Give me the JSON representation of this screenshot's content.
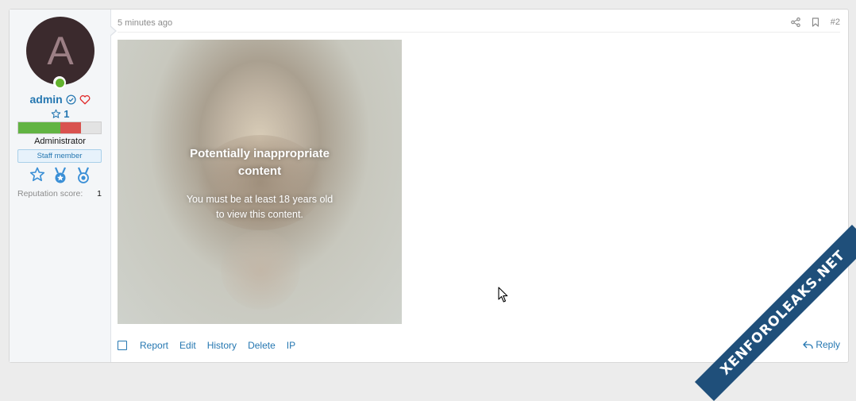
{
  "post": {
    "time": "5 minutes ago",
    "number": "#2"
  },
  "user": {
    "avatar_letter": "A",
    "name": "admin",
    "rank_count": "1",
    "title": "Administrator",
    "badge": "Staff member",
    "reputation_label": "Reputation score:",
    "reputation_value": "1",
    "reputation_bar": {
      "positive_fraction": 0.51,
      "negative_fraction": 0.25
    }
  },
  "content": {
    "overlay_title": "Potentially inappropriate content",
    "overlay_message": "You must be at least 18 years old to view this content."
  },
  "actions": {
    "report": "Report",
    "edit": "Edit",
    "history": "History",
    "delete": "Delete",
    "ip": "IP",
    "reply": "Reply"
  },
  "watermark": "XENFOROLEAKS.NET",
  "colors": {
    "link": "#2577b1",
    "online": "#63b32e",
    "rep_positive": "#62b443",
    "rep_negative": "#d9534f",
    "ribbon": "#1f4f7a"
  }
}
